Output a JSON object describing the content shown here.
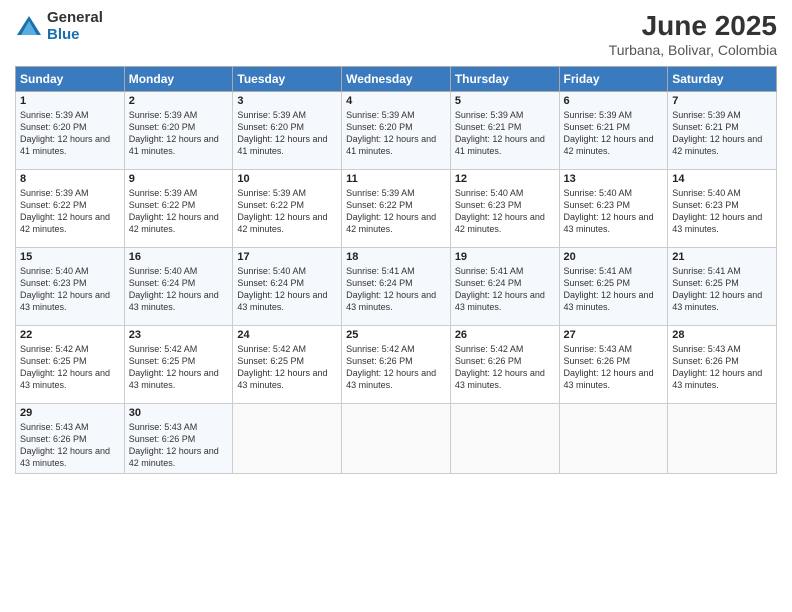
{
  "logo": {
    "general": "General",
    "blue": "Blue"
  },
  "header": {
    "title": "June 2025",
    "subtitle": "Turbana, Bolivar, Colombia"
  },
  "weekdays": [
    "Sunday",
    "Monday",
    "Tuesday",
    "Wednesday",
    "Thursday",
    "Friday",
    "Saturday"
  ],
  "weeks": [
    [
      {
        "day": "1",
        "sunrise": "5:39 AM",
        "sunset": "6:20 PM",
        "daylight": "12 hours and 41 minutes."
      },
      {
        "day": "2",
        "sunrise": "5:39 AM",
        "sunset": "6:20 PM",
        "daylight": "12 hours and 41 minutes."
      },
      {
        "day": "3",
        "sunrise": "5:39 AM",
        "sunset": "6:20 PM",
        "daylight": "12 hours and 41 minutes."
      },
      {
        "day": "4",
        "sunrise": "5:39 AM",
        "sunset": "6:20 PM",
        "daylight": "12 hours and 41 minutes."
      },
      {
        "day": "5",
        "sunrise": "5:39 AM",
        "sunset": "6:21 PM",
        "daylight": "12 hours and 41 minutes."
      },
      {
        "day": "6",
        "sunrise": "5:39 AM",
        "sunset": "6:21 PM",
        "daylight": "12 hours and 42 minutes."
      },
      {
        "day": "7",
        "sunrise": "5:39 AM",
        "sunset": "6:21 PM",
        "daylight": "12 hours and 42 minutes."
      }
    ],
    [
      {
        "day": "8",
        "sunrise": "5:39 AM",
        "sunset": "6:22 PM",
        "daylight": "12 hours and 42 minutes."
      },
      {
        "day": "9",
        "sunrise": "5:39 AM",
        "sunset": "6:22 PM",
        "daylight": "12 hours and 42 minutes."
      },
      {
        "day": "10",
        "sunrise": "5:39 AM",
        "sunset": "6:22 PM",
        "daylight": "12 hours and 42 minutes."
      },
      {
        "day": "11",
        "sunrise": "5:39 AM",
        "sunset": "6:22 PM",
        "daylight": "12 hours and 42 minutes."
      },
      {
        "day": "12",
        "sunrise": "5:40 AM",
        "sunset": "6:23 PM",
        "daylight": "12 hours and 42 minutes."
      },
      {
        "day": "13",
        "sunrise": "5:40 AM",
        "sunset": "6:23 PM",
        "daylight": "12 hours and 43 minutes."
      },
      {
        "day": "14",
        "sunrise": "5:40 AM",
        "sunset": "6:23 PM",
        "daylight": "12 hours and 43 minutes."
      }
    ],
    [
      {
        "day": "15",
        "sunrise": "5:40 AM",
        "sunset": "6:23 PM",
        "daylight": "12 hours and 43 minutes."
      },
      {
        "day": "16",
        "sunrise": "5:40 AM",
        "sunset": "6:24 PM",
        "daylight": "12 hours and 43 minutes."
      },
      {
        "day": "17",
        "sunrise": "5:40 AM",
        "sunset": "6:24 PM",
        "daylight": "12 hours and 43 minutes."
      },
      {
        "day": "18",
        "sunrise": "5:41 AM",
        "sunset": "6:24 PM",
        "daylight": "12 hours and 43 minutes."
      },
      {
        "day": "19",
        "sunrise": "5:41 AM",
        "sunset": "6:24 PM",
        "daylight": "12 hours and 43 minutes."
      },
      {
        "day": "20",
        "sunrise": "5:41 AM",
        "sunset": "6:25 PM",
        "daylight": "12 hours and 43 minutes."
      },
      {
        "day": "21",
        "sunrise": "5:41 AM",
        "sunset": "6:25 PM",
        "daylight": "12 hours and 43 minutes."
      }
    ],
    [
      {
        "day": "22",
        "sunrise": "5:42 AM",
        "sunset": "6:25 PM",
        "daylight": "12 hours and 43 minutes."
      },
      {
        "day": "23",
        "sunrise": "5:42 AM",
        "sunset": "6:25 PM",
        "daylight": "12 hours and 43 minutes."
      },
      {
        "day": "24",
        "sunrise": "5:42 AM",
        "sunset": "6:25 PM",
        "daylight": "12 hours and 43 minutes."
      },
      {
        "day": "25",
        "sunrise": "5:42 AM",
        "sunset": "6:26 PM",
        "daylight": "12 hours and 43 minutes."
      },
      {
        "day": "26",
        "sunrise": "5:42 AM",
        "sunset": "6:26 PM",
        "daylight": "12 hours and 43 minutes."
      },
      {
        "day": "27",
        "sunrise": "5:43 AM",
        "sunset": "6:26 PM",
        "daylight": "12 hours and 43 minutes."
      },
      {
        "day": "28",
        "sunrise": "5:43 AM",
        "sunset": "6:26 PM",
        "daylight": "12 hours and 43 minutes."
      }
    ],
    [
      {
        "day": "29",
        "sunrise": "5:43 AM",
        "sunset": "6:26 PM",
        "daylight": "12 hours and 43 minutes."
      },
      {
        "day": "30",
        "sunrise": "5:43 AM",
        "sunset": "6:26 PM",
        "daylight": "12 hours and 42 minutes."
      },
      null,
      null,
      null,
      null,
      null
    ]
  ]
}
